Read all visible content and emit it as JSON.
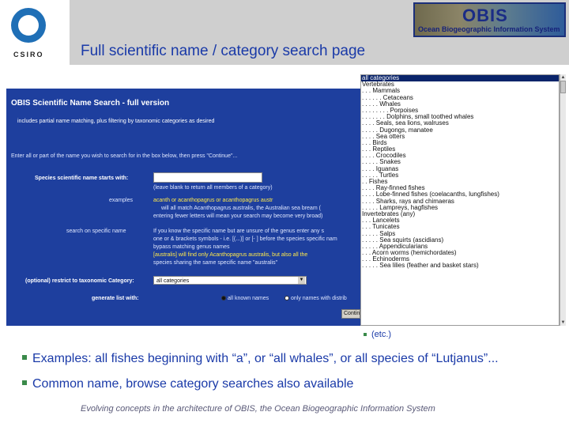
{
  "header": {
    "title": "Full scientific name / category search page",
    "csiro_logo_text": "CSIRO",
    "obis_logo": {
      "word": "OBIS",
      "subtitle": "Ocean Biogeographic Information System"
    }
  },
  "form": {
    "title": "OBIS Scientific Name Search - full version",
    "subtitle": "includes partial name matching, plus filtering by taxonomic categories as desired",
    "instructions": "Enter all or part of the name you wish to search for in the box below, then press \"Continue\"...",
    "species_label": "Species scientific name starts with:",
    "species_value": "",
    "blank_hint": "(leave blank to return all members of a category)",
    "example_label": "examples",
    "example_line1": "acanth or acanthopagrus or acanthopagrus austr",
    "example_line2": "will all match Acanthopagrus australis, the Australian sea bream (",
    "example_line3": "entering fewer letters will mean your search may become very broad)",
    "specific_label": "search on specific name",
    "specific_line1": "If you know the specific name but are unsure of the genus enter any s",
    "specific_line2": "one or & brackets symbols - i.e. [(...)] or [- ] before the species specific nam",
    "specific_line3": "bypass matching genus names",
    "specific_line4": "[australis] will find only Acanthopagrus australis, but also all the",
    "specific_line5": "species sharing the same specific name \"australis\"",
    "category_label": "(optional) restrict to taxonomic Category:",
    "category_value": "all categories",
    "generate_label": "generate list with:",
    "radio1": "all known names",
    "radio2": "only names with distrib",
    "continue_button": "Continue"
  },
  "listbox": {
    "items": [
      "all categories",
      "Vertebrates",
      ". . . Mammals",
      ". . . . . . Cetaceans",
      ". . . . . Whales",
      ". . . . . . . . Porpoises",
      ". . . . . . . Dolphins, small toothed whales",
      ". . . . Seals, sea lions, walruses",
      ". . . . . Dugongs, manatee",
      ". . . . Sea otters",
      ". . . Birds",
      ". . . Reptiles",
      ". . . . Crocodiles",
      ". . . . . Snakes",
      ". . . . Iguanas",
      ". . . . . Turtles",
      ". . Fishes",
      ". . . . Ray-finned fishes",
      ". . . . Lobe-finned fishes (coelacanths, lungfishes)",
      ". . . . Sharks, rays and chimaeras",
      ". . . . . Lampreys, hagfishes",
      "Invertebrates (any)",
      ". . . Lancelets",
      ". . . Tunicates",
      ". . . . . Salps",
      ". . . . . Sea squirts (ascidians)",
      ". . . . . Appendicularians",
      ". . . Acorn worms (hemichordates)",
      ". . . Echinoderms",
      ". . . . . Sea lilies (feather and basket stars)"
    ],
    "selected_index": 0
  },
  "etc_note": "(etc.)",
  "bullets": [
    "Examples: all fishes beginning with “a”, or “all whales”, or all species of “Lutjanus”...",
    "Common name, browse category searches also available"
  ],
  "footer": "Evolving concepts in the architecture of OBIS, the Ocean Biogeographic Information System",
  "colors": {
    "title_blue": "#1a3aa8",
    "panel_blue": "#1e3f9e",
    "bullet_green": "#3a8a4a",
    "header_grey": "#cfcfcf"
  }
}
